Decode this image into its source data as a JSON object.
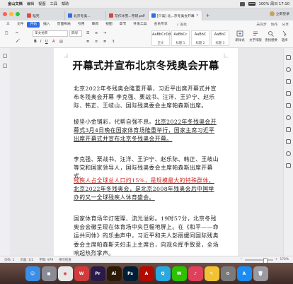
{
  "menubar": {
    "items": [
      "金山文档",
      "编辑",
      "视图",
      "工具",
      "帮助"
    ],
    "right_text": "100% 周日 17:10"
  },
  "tabs": [
    {
      "label": "稻壳",
      "color": "#e14d3c",
      "active": false
    },
    {
      "label": "北京冬奥...",
      "color": "#2f6ee6",
      "active": false
    },
    {
      "label": "写作冰雪...考研.pdf",
      "color": "#d9463a",
      "active": false
    },
    {
      "label": "[只读] 北...京冬奥会开幕",
      "color": "#2f6ee6",
      "active": true
    }
  ],
  "account_label": "立即登录",
  "ribbon_tabs": [
    "三",
    "文件",
    "开始",
    "插入",
    "页面布局",
    "引用",
    "审阅",
    "视图",
    "章节",
    "开发工具",
    "会员专享"
  ],
  "active_ribbon_tab": "开始",
  "search_label": "查找",
  "ribbon_right": [
    "未同步",
    "协作",
    "分享"
  ],
  "font": {
    "name": "华文仿宋",
    "size": "四号"
  },
  "styles": [
    {
      "sample": "AaBbCcDd",
      "label": "正文"
    },
    {
      "sample": "AaBbCc",
      "label": "标题 1"
    },
    {
      "sample": "AaBbC",
      "label": "标题 2"
    },
    {
      "sample": "AaBbC",
      "label": "标题 3"
    }
  ],
  "big_buttons": [
    "新样式",
    "文字排版",
    "查找替换",
    "选择"
  ],
  "document": {
    "title": "开幕式并宣布北京冬残奥会开幕",
    "p1": "北京2022年冬残奥会隆重开幕，习近平出席开幕式并宣布冬残奥会开幕 李克强、栗战书、汪洋、王沪宁、赵乐际、韩正、王岐山、国际残奥委会主席帕森斯出席。",
    "p2_a": "披坚小金铺彩，代帮自强不息。",
    "p2_b": "北京2022年冬残奥会开幕式3月4日晚在国家体育场隆重举行，国家主席习近平出席开幕式并宣布北京冬残奥会开幕。",
    "p3": "李克强、栗战书、汪洋、王沪宁、赵乐际、韩正、王岐山等党和国家领导人，国际残奥委会主席帕森斯出席开幕式。",
    "p4_red": "残疾人占全球总人口约15%，是规模最大的特殊群体。",
    "p4_b": "北京2022年冬残奥会，是北京2008年残奥会后中国举办的又一全球残疾人体育盛会。",
    "p5": "国家体育场华灯璀璨、流光溢彩。19时57分，北京冬残奥会会徽呈现在体育场中央巨幅地屏上。在《和平——命运共同体》的乐曲声中，习近平和夫人彭丽媛同国际残奥委会主席帕森斯夫妇走上主席台，向观众挥手致意，全场响起热烈掌声。"
  },
  "statusbar": {
    "page": "页码: 1",
    "pages": "页面: 1/2",
    "words": "字数: 979",
    "spell": "拼写检查",
    "zoom": "170%"
  },
  "dock_apps": [
    {
      "name": "finder",
      "color": "#3a8ee6",
      "glyph": "☺"
    },
    {
      "name": "launchpad",
      "color": "#8b8b96",
      "glyph": "◼"
    },
    {
      "name": "chrome",
      "color": "#e8e8e8",
      "glyph": "◉"
    },
    {
      "name": "wps",
      "color": "#d23b3b",
      "glyph": "W"
    },
    {
      "name": "premiere",
      "color": "#2a1a4a",
      "glyph": "Pr"
    },
    {
      "name": "illustrator",
      "color": "#2b1a07",
      "glyph": "Ai"
    },
    {
      "name": "photoshop",
      "color": "#001e36",
      "glyph": "Ps"
    },
    {
      "name": "acrobat",
      "color": "#b30b00",
      "glyph": "A"
    },
    {
      "name": "qq",
      "color": "#2aa8e0",
      "glyph": "Q"
    },
    {
      "name": "wechat",
      "color": "#2dc100",
      "glyph": "W"
    },
    {
      "name": "music",
      "color": "#e0405a",
      "glyph": "♪"
    },
    {
      "name": "notes",
      "color": "#f1c232",
      "glyph": "✎"
    },
    {
      "name": "system-prefs",
      "color": "#7a7a7a",
      "glyph": "⚙"
    },
    {
      "name": "app-store",
      "color": "#1b8cf2",
      "glyph": "A"
    },
    {
      "name": "trash",
      "color": "#9a9aa0",
      "glyph": "🗑"
    }
  ]
}
